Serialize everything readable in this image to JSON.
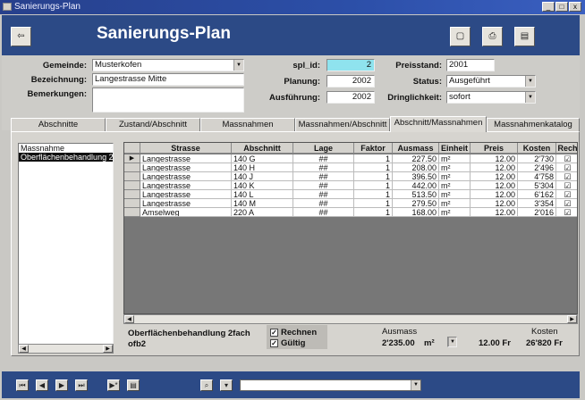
{
  "window": {
    "title": "Sanierungs-Plan",
    "controls": [
      "_",
      "□",
      "x"
    ]
  },
  "header": {
    "title": "Sanierungs-Plan",
    "buttons": [
      "print-preview",
      "print",
      "report"
    ]
  },
  "form": {
    "gemeinde_label": "Gemeinde:",
    "gemeinde_value": "Musterkofen",
    "bezeichnung_label": "Bezeichnung:",
    "bezeichnung_value": "Langestrasse Mitte",
    "bemerkungen_label": "Bemerkungen:",
    "bemerkungen_value": "",
    "spl_id_label": "spl_id:",
    "spl_id_value": "2",
    "planung_label": "Planung:",
    "planung_value": "2002",
    "ausfuehrung_label": "Ausführung:",
    "ausfuehrung_value": "2002",
    "preisstand_label": "Preisstand:",
    "preisstand_value": "2001",
    "status_label": "Status:",
    "status_value": "Ausgeführt",
    "dringlichkeit_label": "Dringlichkeit:",
    "dringlichkeit_value": "sofort"
  },
  "tabs": [
    "Abschnitte",
    "Zustand/Abschnitt",
    "Massnahmen",
    "Massnahmen/Abschnitt",
    "Abschnitt/Massnahmen",
    "Massnahmenkatalog"
  ],
  "active_tab": 4,
  "list": {
    "header": "Massnahme",
    "items": [
      "Oberflächenbehandlung 2"
    ]
  },
  "grid": {
    "columns": [
      "Strasse",
      "Abschnitt",
      "Lage",
      "Faktor",
      "Ausmass",
      "Einheit",
      "Preis",
      "Kosten",
      "Rech"
    ],
    "rows": [
      [
        "Langestrasse",
        "140 G",
        "__ ## __",
        "1",
        "227.50",
        "m²",
        "12.00",
        "2'730",
        "☑"
      ],
      [
        "Langestrasse",
        "140 H",
        "__ ## __",
        "1",
        "208.00",
        "m²",
        "12.00",
        "2'496",
        "☑"
      ],
      [
        "Langestrasse",
        "140 J",
        "__ ## __",
        "1",
        "396.50",
        "m²",
        "12.00",
        "4'758",
        "☑"
      ],
      [
        "Langestrasse",
        "140 K",
        "__ ## __",
        "1",
        "442.00",
        "m²",
        "12.00",
        "5'304",
        "☑"
      ],
      [
        "Langestrasse",
        "140 L",
        "__ ## __",
        "1",
        "513.50",
        "m²",
        "12.00",
        "6'162",
        "☑"
      ],
      [
        "Langestrasse",
        "140 M",
        "__ ## __",
        "1",
        "279.50",
        "m²",
        "12.00",
        "3'354",
        "☑"
      ],
      [
        "Amselweg",
        "220 A",
        "__ ## __",
        "1",
        "168.00",
        "m²",
        "12.00",
        "2'016",
        "☑"
      ]
    ]
  },
  "footer": {
    "massnahme_name": "Oberflächenbehandlung 2fach",
    "massnahme_code": "ofb2",
    "rechnen_label": "Rechnen",
    "rechnen_checked": true,
    "gueltig_label": "Gültig",
    "gueltig_checked": true,
    "ausmass_label": "Ausmass",
    "ausmass_value": "2'235.00",
    "einheit_value": "m²",
    "preis_value": "12.00 Fr",
    "kosten_label": "Kosten",
    "kosten_value": "26'820 Fr"
  },
  "navbar": {
    "buttons": [
      "first-record",
      "previous-record",
      "next-record",
      "last-record",
      "new-record",
      "form-view",
      "find",
      "filter"
    ],
    "search_value": ""
  }
}
